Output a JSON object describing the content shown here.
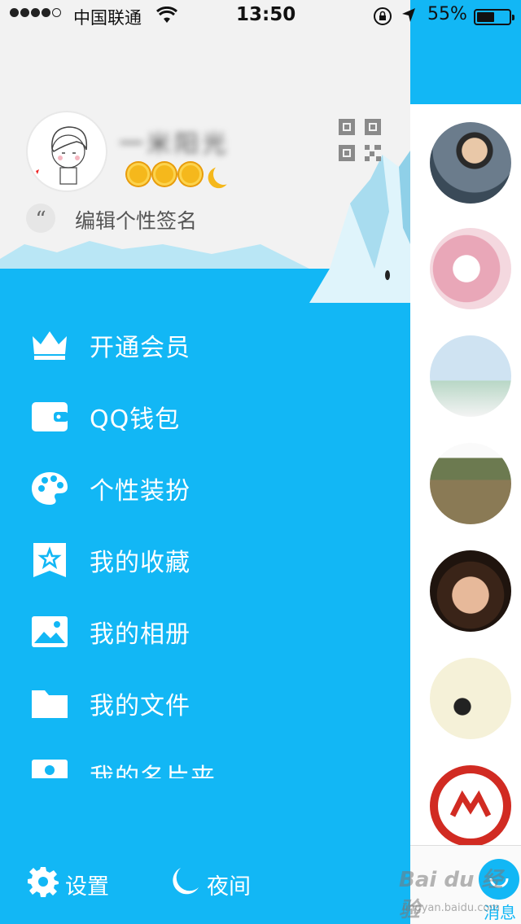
{
  "status_bar": {
    "carrier": "中国联通",
    "time": "13:50",
    "battery_pct": "55%",
    "battery_level": 0.55
  },
  "profile": {
    "nickname": "一米阳光",
    "signature_placeholder": "编辑个性签名",
    "level_icons": [
      "sun",
      "sun",
      "sun",
      "moon"
    ]
  },
  "menu": {
    "items": [
      {
        "label": "开通会员",
        "icon": "crown-icon"
      },
      {
        "label": "QQ钱包",
        "icon": "wallet-icon"
      },
      {
        "label": "个性装扮",
        "icon": "palette-icon"
      },
      {
        "label": "我的收藏",
        "icon": "favorites-icon"
      },
      {
        "label": "我的相册",
        "icon": "album-icon"
      },
      {
        "label": "我的文件",
        "icon": "folder-icon"
      },
      {
        "label": "我的名片夹",
        "icon": "card-holder-icon"
      }
    ]
  },
  "bottom": {
    "settings_label": "设置",
    "night_label": "夜间"
  },
  "tabbar": {
    "messages_label": "消息"
  },
  "watermark": {
    "text": "Bai du 经验",
    "sub": "jingyan.baidu.com"
  },
  "colors": {
    "accent": "#12b7f5",
    "drawer_top": "#f2f2f2"
  }
}
